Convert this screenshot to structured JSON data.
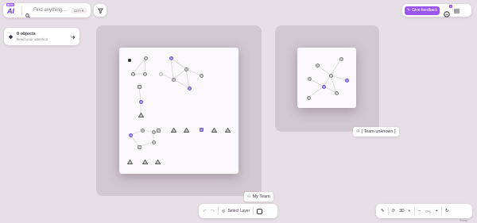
{
  "logo": {
    "badge": "BETA",
    "mark": "AI"
  },
  "search": {
    "placeholder": "Find anything...",
    "shortcut": "Ctrl+K"
  },
  "feedback": {
    "label": "Give feedback"
  },
  "notifications": {
    "count": "1"
  },
  "objects_card": {
    "title": "0 objects",
    "subtitle": "Need your attention"
  },
  "regions": [
    {
      "label": "My Team"
    },
    {
      "label": "[ Team unknown ]"
    }
  ],
  "bottom_toolbar": {
    "select_layer": "Select Layer"
  },
  "view_toolbar": {
    "mode_3d": "3D",
    "zoom": "0%"
  },
  "footer": {
    "text": "Stamp"
  }
}
